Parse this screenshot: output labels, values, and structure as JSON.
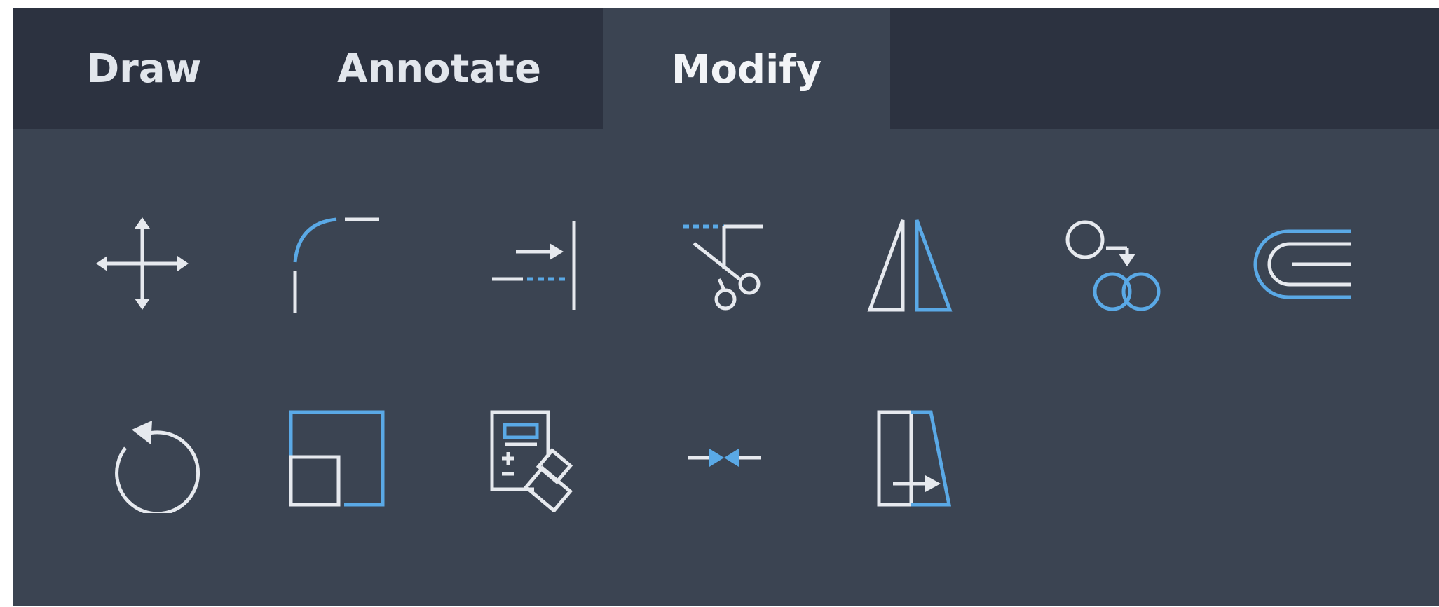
{
  "tabs": [
    {
      "label": "Draw",
      "active": false
    },
    {
      "label": "Annotate",
      "active": false
    },
    {
      "label": "Modify",
      "active": true
    }
  ],
  "tools": [
    {
      "name": "move",
      "icon": "move-icon"
    },
    {
      "name": "fillet",
      "icon": "fillet-icon"
    },
    {
      "name": "extend",
      "icon": "extend-icon"
    },
    {
      "name": "trim",
      "icon": "trim-icon"
    },
    {
      "name": "mirror",
      "icon": "mirror-icon"
    },
    {
      "name": "copy",
      "icon": "copy-icon"
    },
    {
      "name": "offset",
      "icon": "offset-icon"
    },
    {
      "name": "rotate",
      "icon": "rotate-icon"
    },
    {
      "name": "scale",
      "icon": "scale-icon"
    },
    {
      "name": "match-properties",
      "icon": "match-properties-icon"
    },
    {
      "name": "join",
      "icon": "join-icon"
    },
    {
      "name": "stretch",
      "icon": "stretch-icon"
    }
  ],
  "colors": {
    "panel_bg": "#3b4452",
    "tabbar_bg": "#2c3240",
    "icon_white": "#e6e9ee",
    "icon_blue": "#5aa9e6"
  }
}
